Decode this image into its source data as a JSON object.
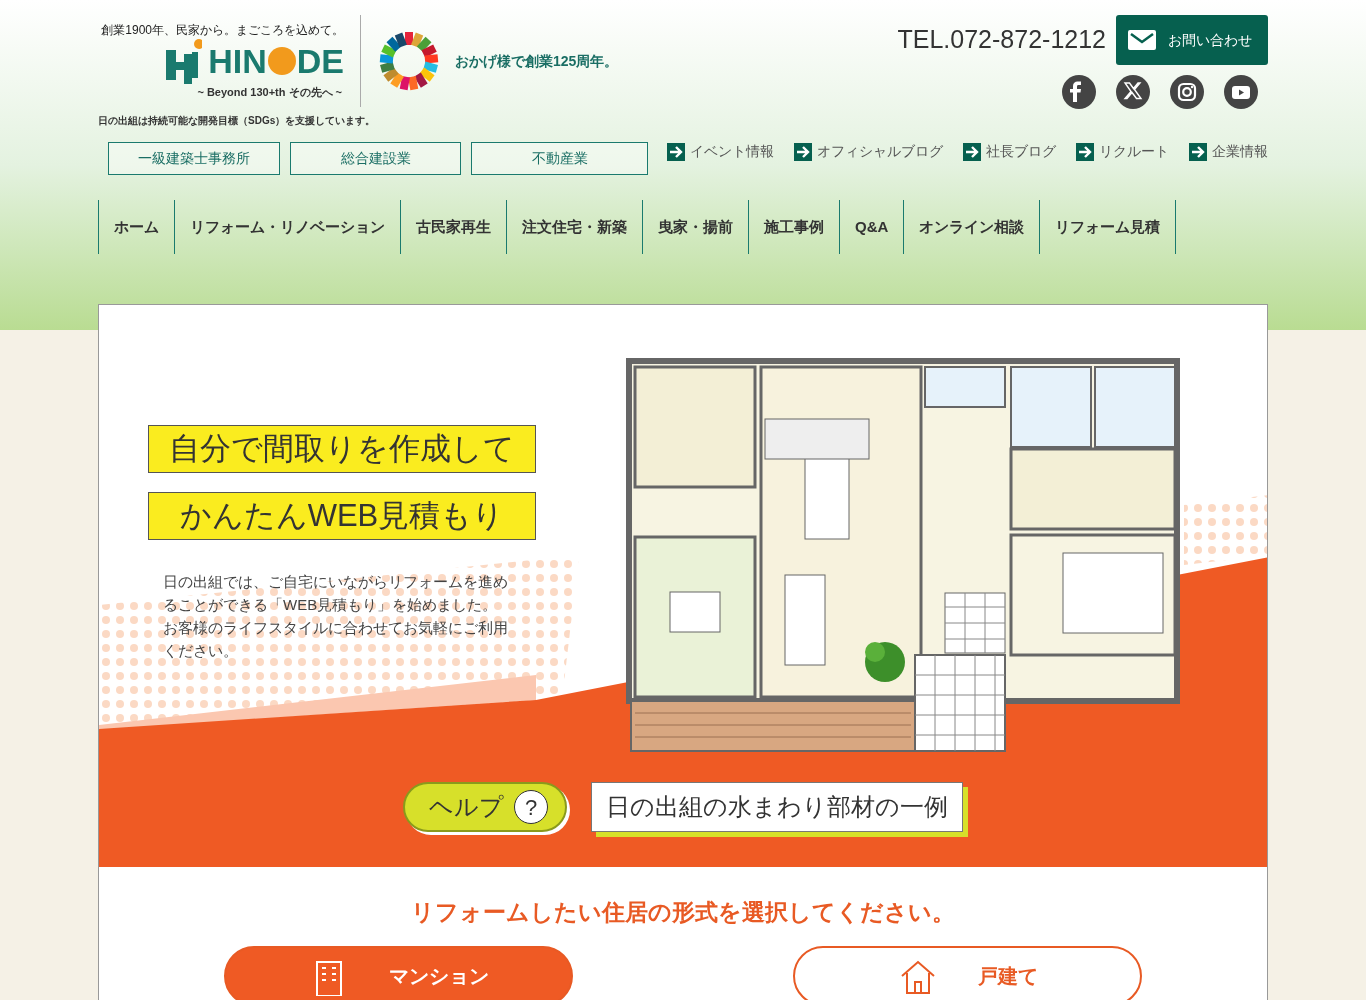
{
  "header": {
    "tagline": "創業1900年、民家から。まごころを込めて。",
    "logo_left": "HIN",
    "logo_right": "DE",
    "logo_sub": "~ Beyond 130+th その先へ ~",
    "anniversary": "おかげ様で創業125周年。",
    "sdgs_note": "日の出組は持続可能な開発目標（SDGs）を支援しています。",
    "phone": "TEL.072-872-1212",
    "contact_button": "お問い合わせ"
  },
  "business_links": [
    "一級建築士事務所",
    "総合建設業",
    "不動産業"
  ],
  "sub_links": [
    "イベント情報",
    "オフィシャルブログ",
    "社長ブログ",
    "リクルート",
    "企業情報"
  ],
  "social": [
    {
      "kind": "facebook"
    },
    {
      "kind": "x"
    },
    {
      "kind": "instagram"
    },
    {
      "kind": "youtube"
    }
  ],
  "nav": [
    "ホーム",
    "リフォーム・リノベーション",
    "古民家再生",
    "注文住宅・新築",
    "曳家・揚前",
    "施工事例",
    "Q&A",
    "オンライン相談",
    "リフォーム見積"
  ],
  "hero": {
    "headline": [
      "自分で間取りを作成して",
      "かんたんWEB見積もり"
    ],
    "description": [
      "日の出組では、ご自宅にいながらリフォームを進めることができる「WEB見積もり」を始めました。",
      "お客様のライフスタイルに合わせてお気軽にご利用ください。"
    ],
    "help_button": "ヘルプ",
    "help_icon": "?",
    "example_label": "日の出組の水まわり部材の一例"
  },
  "select": {
    "heading": "リフォームしたい住居の形式を選択してください。",
    "options": [
      {
        "label": "マンション",
        "selected": true
      },
      {
        "label": "戸建て",
        "selected": false
      }
    ]
  }
}
